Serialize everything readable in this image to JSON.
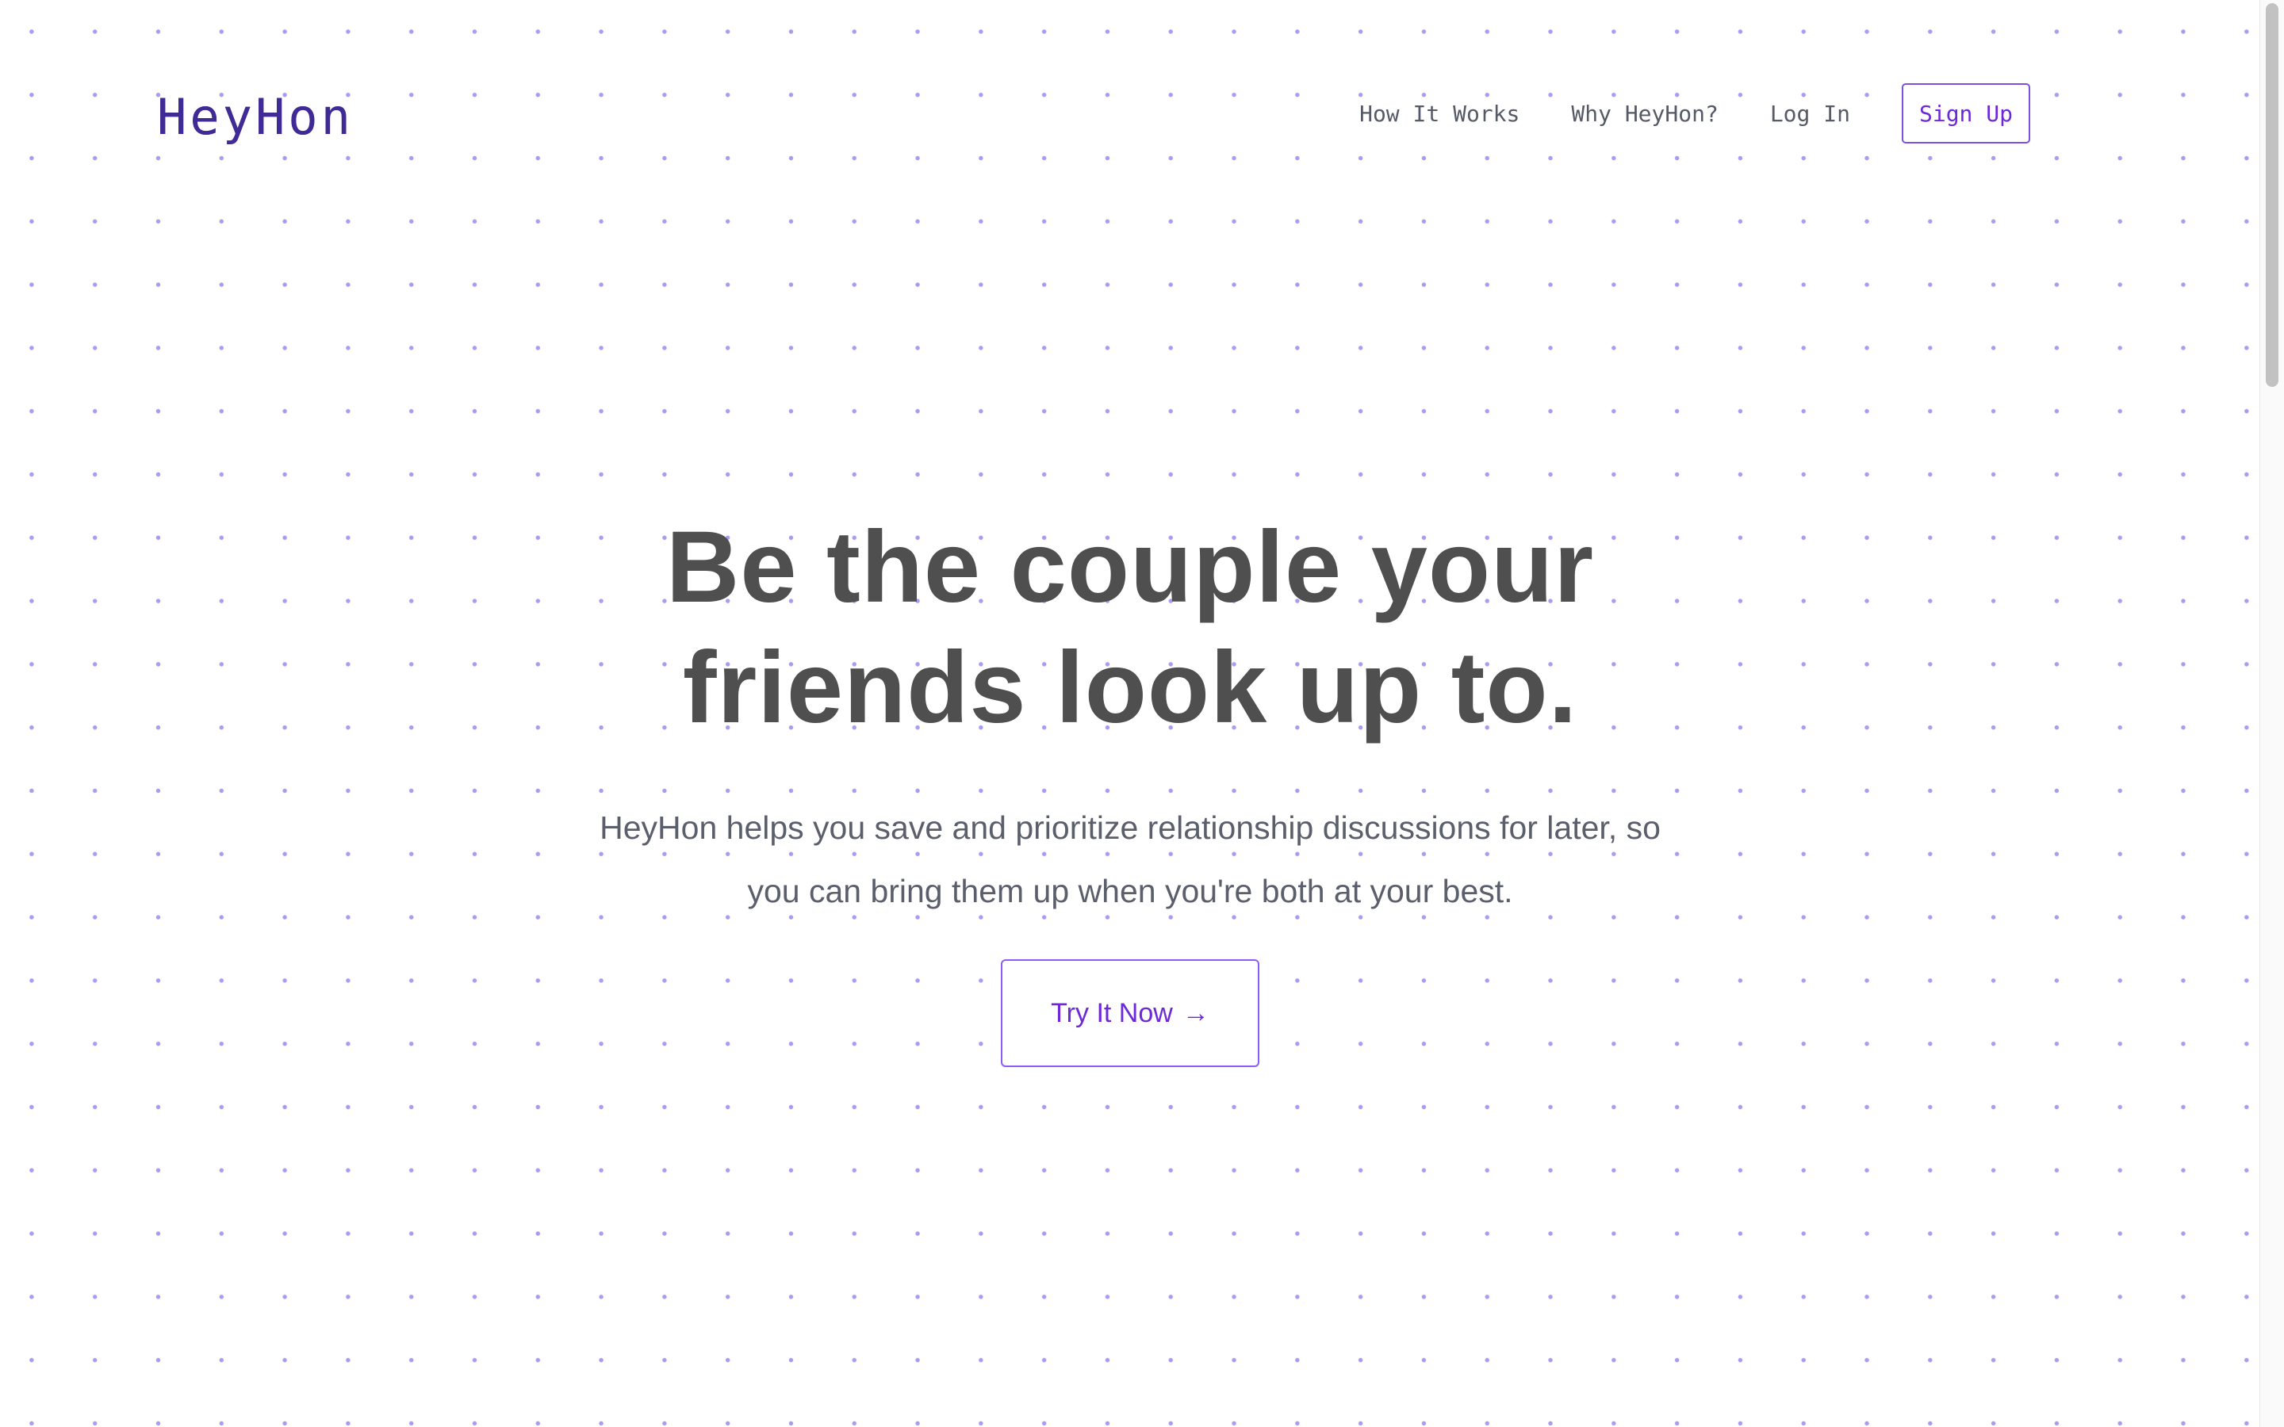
{
  "header": {
    "logo": "HeyHon",
    "nav": {
      "how_it_works": "How It Works",
      "why_heyhon": "Why HeyHon?",
      "log_in": "Log In",
      "sign_up": "Sign Up"
    }
  },
  "hero": {
    "headline_line1": "Be the couple your",
    "headline_line2": "friends look up to.",
    "subtext_line1": "HeyHon helps you save and prioritize relationship discussions for later, so",
    "subtext_line2": "you can bring them up when you're both at your best.",
    "cta_label": "Try It Now",
    "cta_arrow": "→"
  },
  "colors": {
    "accent": "#6d28d9",
    "dot_grid": "#a99cf0",
    "heading": "#4f4f4f",
    "body_text": "#5b5f6b"
  },
  "icons": {
    "cta_arrow": "arrow-right-icon"
  }
}
